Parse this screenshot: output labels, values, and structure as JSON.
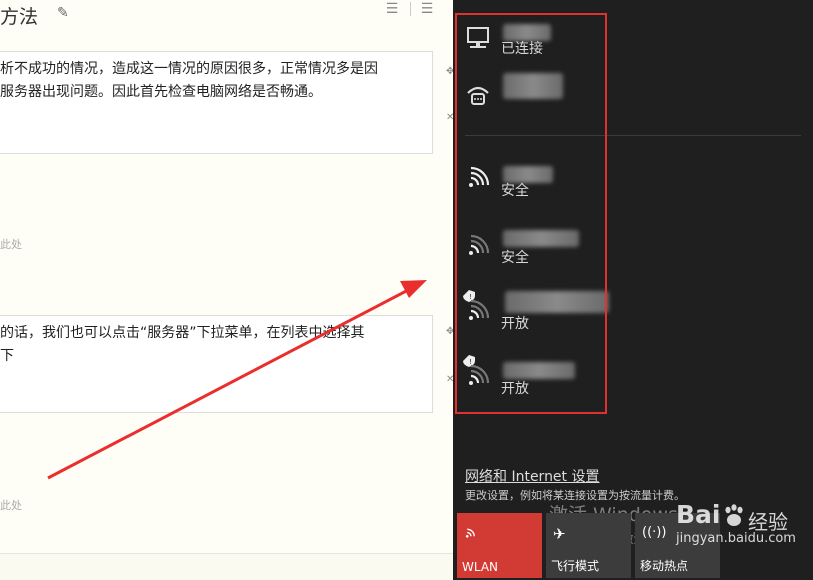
{
  "editor": {
    "title": "方法",
    "step1_line1": "析不成功的情况，造成这一情况的原因很多，正常情况多是因",
    "step1_line2": "服务器出现问题。因此首先检查电脑网络是否畅通。",
    "placeholder1": "此处",
    "step2_line1": "的话，我们也可以点击“服务器”下拉菜单，在列表中选择其",
    "step2_line2": "下",
    "placeholder2": "此处"
  },
  "flyout": {
    "networks": [
      {
        "icon": "ethernet-icon",
        "status": "已连接"
      },
      {
        "icon": "dialup-icon",
        "status": ""
      },
      {
        "icon": "wifi-icon",
        "status": "安全"
      },
      {
        "icon": "wifi-icon",
        "status": "安全"
      },
      {
        "icon": "wifi-open-icon",
        "status": "开放"
      },
      {
        "icon": "wifi-open-icon",
        "status": "开放"
      }
    ],
    "settings_link": "网络和 Internet 设置",
    "settings_desc": "更改设置，例如将某连接设置为按流量计费。",
    "activation_title": "激活 Windows",
    "activation_desc": "转到“设置”以激活 Windows。",
    "tiles": [
      {
        "label": "WLAN",
        "active": true
      },
      {
        "label": "飞行模式",
        "active": false
      },
      {
        "label": "移动热点",
        "active": false
      }
    ]
  },
  "watermark": {
    "brand": "Bai",
    "brand_cn": "经验",
    "url": "jingyan.baidu.com"
  },
  "colors": {
    "flyout_bg": "#1f1f1f",
    "accent_red": "#d23b34",
    "highlight_frame": "#e03131",
    "arrow": "#ea2e2e"
  }
}
